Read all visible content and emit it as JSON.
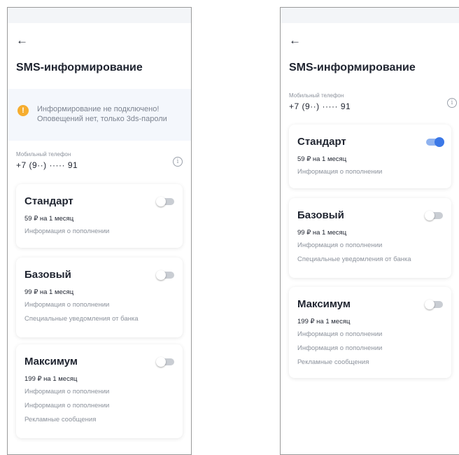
{
  "colors": {
    "accent": "#3b78e7",
    "warning": "#f6ad2f",
    "toggle_off": "#c9cdd3"
  },
  "icons": {
    "back": "arrow-left-icon",
    "warning": "exclamation-circle-icon",
    "info": "info-circle-icon"
  },
  "left": {
    "back": "←",
    "title": "SMS-информирование",
    "notice": {
      "icon": "!",
      "line1": "Информирование не подключено!",
      "line2": "Оповещений нет, только 3ds-пароли"
    },
    "phone_label": "Мобильный телефон",
    "phone_value": "+7 (9··) ····· 91",
    "info": "i",
    "plans": [
      {
        "name": "Стандарт",
        "price": "59 ₽ на 1 месяц",
        "enabled": false,
        "features": [
          "Информация о пополнении"
        ]
      },
      {
        "name": "Базовый",
        "price": "99 ₽ на 1 месяц",
        "enabled": false,
        "features": [
          "Информация о пополнении",
          "Специальные уведомления от банка"
        ]
      },
      {
        "name": "Максимум",
        "price": "199 ₽ на 1 месяц",
        "enabled": false,
        "features": [
          "Информация о пополнении",
          "Информация о пополнении",
          "Рекламные сообщения"
        ]
      }
    ]
  },
  "right": {
    "back": "←",
    "title": "SMS-информирование",
    "phone_label": "Мобильный телефон",
    "phone_value": "+7 (9··) ····· 91",
    "info": "i",
    "plans": [
      {
        "name": "Стандарт",
        "price": "59 ₽ на 1 месяц",
        "enabled": true,
        "features": [
          "Информация о пополнении"
        ]
      },
      {
        "name": "Базовый",
        "price": "99 ₽ на 1 месяц",
        "enabled": false,
        "features": [
          "Информация о пополнении",
          "Специальные уведомления от банка"
        ]
      },
      {
        "name": "Максимум",
        "price": "199 ₽ на 1 месяц",
        "enabled": false,
        "features": [
          "Информация о пополнении",
          "Информация о пополнении",
          "Рекламные сообщения"
        ]
      }
    ]
  }
}
